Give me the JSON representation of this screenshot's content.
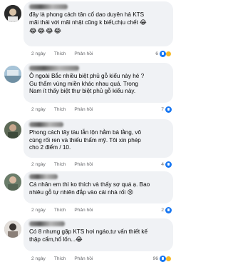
{
  "comments": [
    {
      "text": "đây là phong cách tân cổ dao duyên hả KTS\nmãi thái với mãi nhật cũng k biết,chịu chết 😂",
      "emoji_line": "😂😂😂😂",
      "time": "2 ngày",
      "like": "Thích",
      "reply": "Phản hồi",
      "reactions": "6"
    },
    {
      "text": "Ô ngoài Bắc nhiều biệt phủ gỗ kiểu này hé ?\nGu thẩm vùng miền khác nhau quá. Trong\nNam ít thấy biệt thự biệt phủ gỗ kiểu này.",
      "time": "2 ngày",
      "like": "Thích",
      "reply": "Phản hồi",
      "reactions": "7"
    },
    {
      "text": "Phong cách tây tàu lẫn lộn hằm bà lằng, vô\ncùng rối ren và thiếu thẩm mỹ. Tôi xin phép\ncho 2 điểm / 10.",
      "time": "2 ngày",
      "like": "Thích",
      "reply": "Phản hồi",
      "reactions": "4"
    },
    {
      "text": "Cá nhân em thì ko thích và thấy sợ quá ạ. Bao\nnhiêu gỗ tự nhiên đắp vào cái nhà rối 😢",
      "time": "2 ngày",
      "like": "Thích",
      "reply": "Phản hồi",
      "reactions": "2"
    },
    {
      "text": "Có 8 nhưng gặp KTS hơi ngáo,tư vấn thiết kế\nthập cẩm,hổ lốn...😂",
      "time": "2 ngày",
      "like": "Thích",
      "reply": "Phản hồi",
      "reactions": "96"
    }
  ]
}
